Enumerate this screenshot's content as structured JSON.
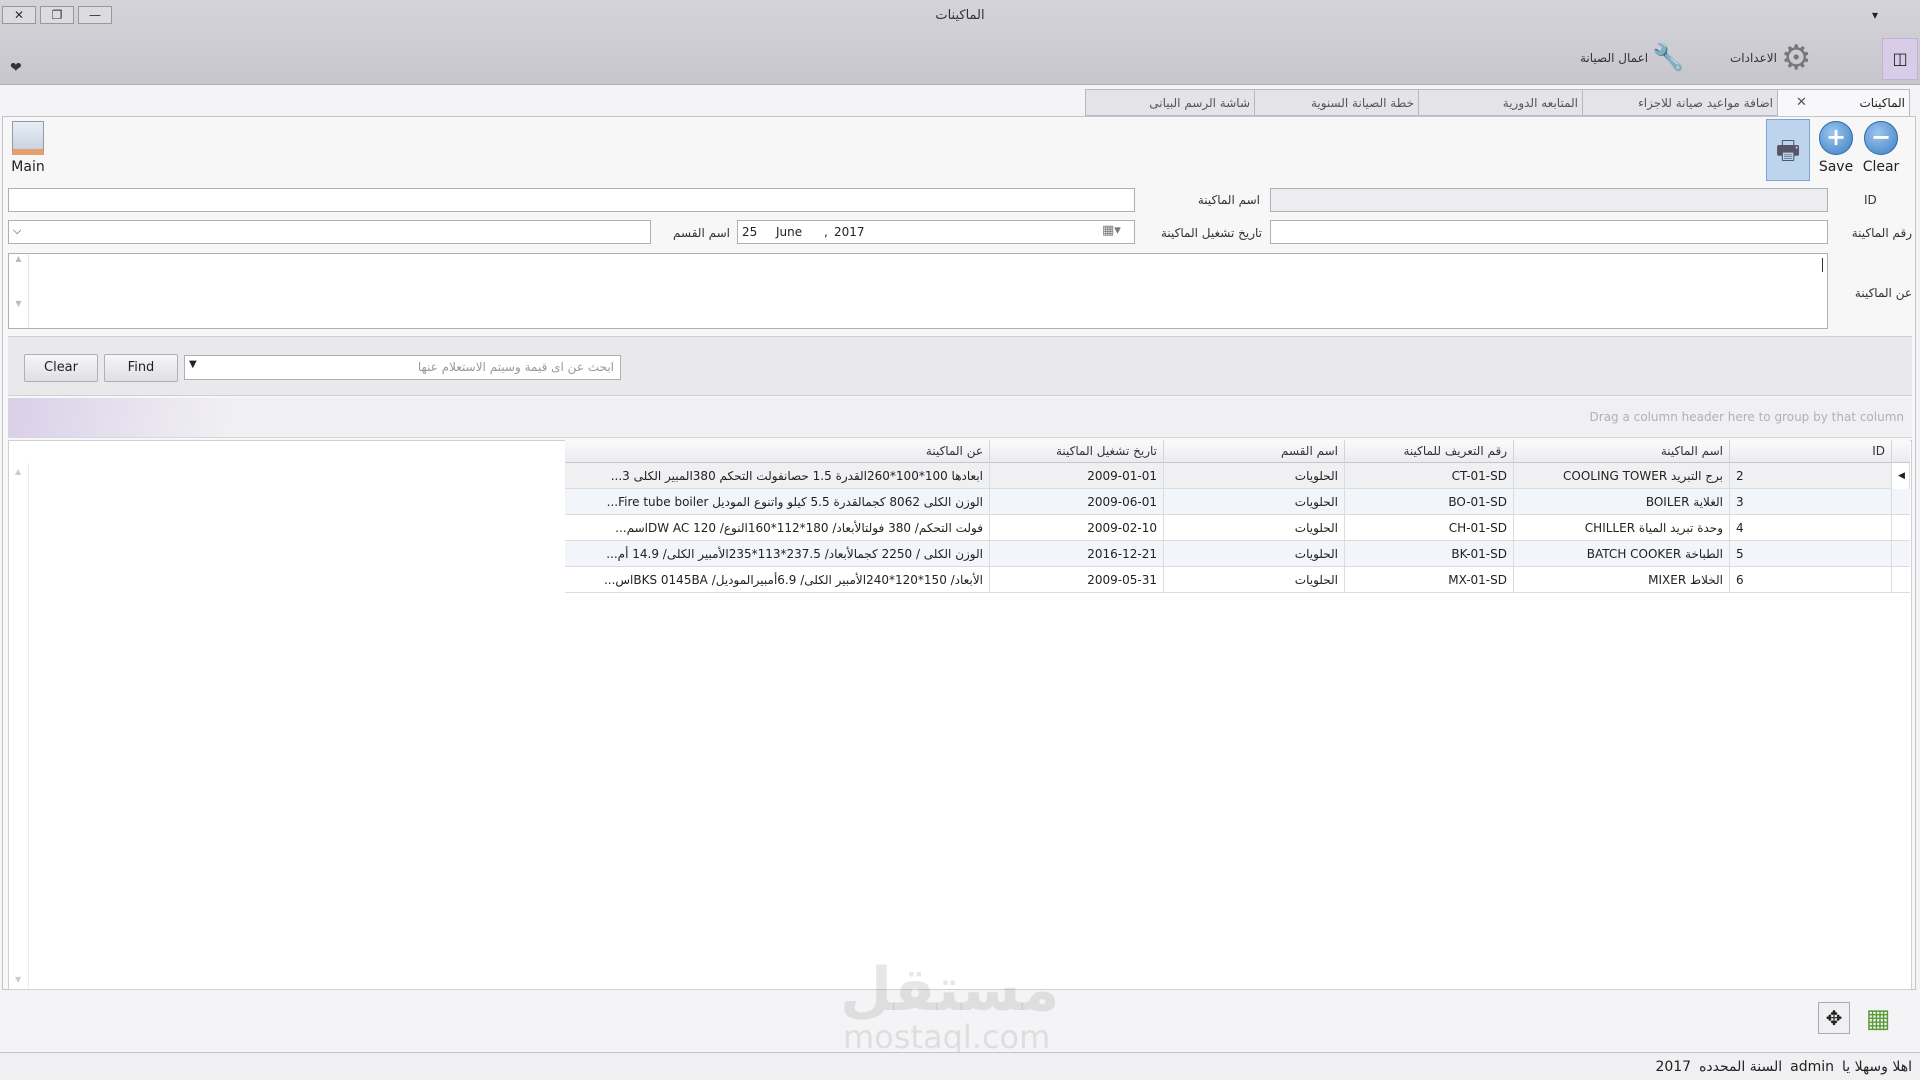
{
  "window": {
    "title": "الماكينات",
    "close": "✕",
    "restore": "❐",
    "minimize": "—",
    "menu_arrow": "▾",
    "collapse": "❤"
  },
  "ribbon": {
    "settings_label": "الاعدادات",
    "maintenance_label": "اعمال الصيانة"
  },
  "tabs": [
    {
      "label": "الماكينات",
      "active": true,
      "close": "✕"
    },
    {
      "label": "اضافة مواعيد صيانة للاجزاء"
    },
    {
      "label": "المتابعه الدورية"
    },
    {
      "label": "خطة الصيانة السنوية"
    },
    {
      "label": "شاشة الرسم البيانى"
    }
  ],
  "toolbar": {
    "main_label": "Main",
    "save_label": "Save",
    "clear_label": "Clear"
  },
  "form": {
    "id_label": "ID",
    "id_value": "",
    "machine_name_label": "اسم الماكينة",
    "machine_name_value": "",
    "machine_no_label": "رقم الماكينة",
    "machine_no_value": "",
    "start_date_label": "تاريخ تشغيل الماكينة",
    "start_date": {
      "day": "25",
      "month": "June",
      "year": "2017"
    },
    "section_label": "اسم القسم",
    "section_value": "",
    "about_label": "عن الماكينة",
    "about_value": ""
  },
  "search": {
    "clear_label": "Clear",
    "find_label": "Find",
    "placeholder": "ابحث عن اى قيمة وسيتم الاستعلام عنها"
  },
  "grid": {
    "group_hint": "Drag a column header here to group by that column",
    "columns": [
      "ID",
      "اسم الماكينة",
      "رقم التعريف للماكينة",
      "اسم القسم",
      "تاريخ تشغيل الماكينة",
      "عن الماكينة"
    ],
    "rows": [
      {
        "id": "2",
        "name": "برج التبريد COOLING TOWER",
        "code": "CT-01-SD",
        "section": "الحلويات",
        "date": "2009-01-01",
        "about": "ابعادها 100*100*260القدرة 1.5 حصانفولت التحكم 380المبير الكلى 3..."
      },
      {
        "id": "3",
        "name": "الغلاية BOILER",
        "code": "BO-01-SD",
        "section": "الحلويات",
        "date": "2009-06-01",
        "about": "الوزن الكلى 8062 كجمالقدرة 5.5 كيلو واتنوع الموديل Fire tube boiler..."
      },
      {
        "id": "4",
        "name": "وحدة تبريد المياة   CHILLER",
        "code": "CH-01-SD",
        "section": "الحلويات",
        "date": "2009-02-10",
        "about": "فولت التحكم/ 380 فولتالأبعاد/ 180*112*160النوع/ DW AC 120اسم..."
      },
      {
        "id": "5",
        "name": "الطباخة BATCH COOKER",
        "code": "BK-01-SD",
        "section": "الحلويات",
        "date": "2016-12-21",
        "about": "الوزن الكلى / 2250 كجمالأبعاد/ 237.5*113*235الأمبير الكلى/ 14.9 أم..."
      },
      {
        "id": "6",
        "name": "الخلاط MIXER",
        "code": "MX-01-SD",
        "section": "الحلويات",
        "date": "2009-05-31",
        "about": "الأبعاد/ 150*120*240الأمبير الكلى/ 6.9أمبيرالموديل/ BKS 0145BAاس..."
      }
    ]
  },
  "status": {
    "welcome": "اهلا وسهلا يا",
    "user": "admin",
    "year_label": "السنة المحدده",
    "year": "2017"
  },
  "watermark": {
    "text": "مستقل",
    "url_text": "mostaql.com"
  }
}
